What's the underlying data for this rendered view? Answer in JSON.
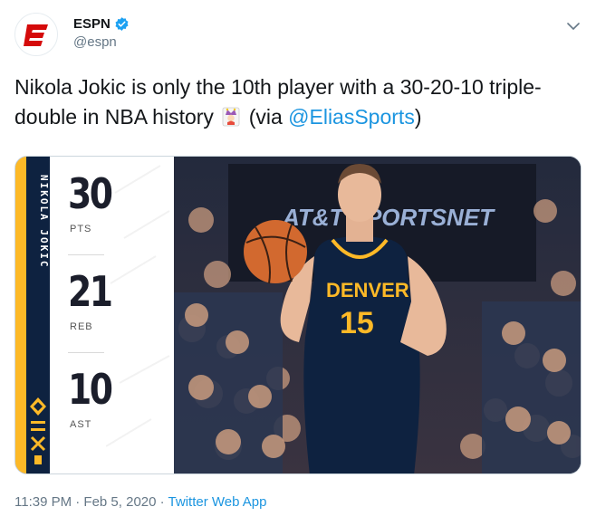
{
  "account": {
    "display_name": "ESPN",
    "handle": "@espn",
    "avatar_icon": "espn-logo-icon",
    "verified_icon": "verified-badge-icon",
    "brand_color": "#d50a0a"
  },
  "tweet": {
    "text_main": "Nikola Jokic is only the 10th player with a 30-20-10 triple-double in NBA history",
    "emoji_icon": "joker-emoji-icon",
    "via_prefix": "(via ",
    "mention": "@EliasSports",
    "via_suffix": ")",
    "link_color": "#1b95e0"
  },
  "media": {
    "player_name": "NIKOLA JOKIC",
    "stats": [
      {
        "value": "30",
        "label": "PTS"
      },
      {
        "value": "21",
        "label": "REB"
      },
      {
        "value": "10",
        "label": "AST"
      }
    ],
    "jersey_team": "DENVER",
    "jersey_number": "15",
    "banner_text": "AT&T SPORTSNET",
    "team_colors": {
      "navy": "#0e2240",
      "gold": "#fdb927"
    }
  },
  "footer": {
    "timestamp": "11:39 PM · Feb 5, 2020 · ",
    "app": "Twitter Web App"
  }
}
